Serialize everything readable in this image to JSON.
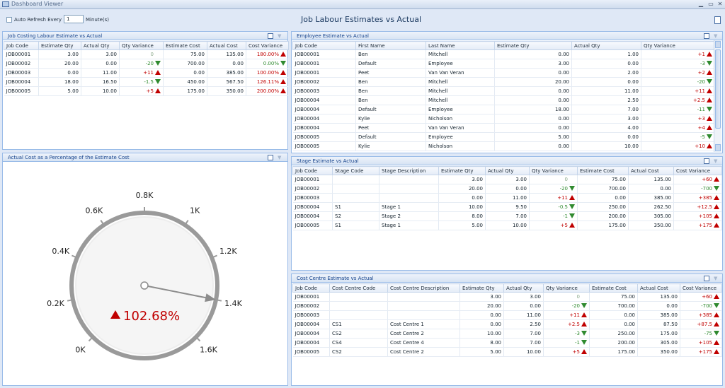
{
  "window": {
    "title": "Dashboard Viewer"
  },
  "toolbar": {
    "auto_refresh_label": "Auto Refresh Every",
    "refresh_value": "1",
    "unit_label": "Minute(s)"
  },
  "dashboard_title": "Job Labour Estimates vs Actual",
  "colors": {
    "up": "#c00000",
    "down": "#2f8a2f",
    "panel_header": "#15428b"
  },
  "job_costing": {
    "title": "Job Costing Labour Estimate vs Actual",
    "columns": [
      "Job Code",
      "Estimate Qty",
      "Actual Qty",
      "Qty Variance",
      "Estimate Cost",
      "Actual Cost",
      "Cost Variance"
    ],
    "rows": [
      {
        "cells": [
          "JOB00001",
          "3.00",
          "3.00",
          "0",
          "75.00",
          "135.00",
          "180.00%"
        ],
        "qty_dir": "none",
        "cost_dir": "up"
      },
      {
        "cells": [
          "JOB00002",
          "20.00",
          "0.00",
          "-20",
          "700.00",
          "0.00",
          "0.00%"
        ],
        "qty_dir": "down",
        "cost_dir": "down"
      },
      {
        "cells": [
          "JOB00003",
          "0.00",
          "11.00",
          "+11",
          "0.00",
          "385.00",
          "100.00%"
        ],
        "qty_dir": "up",
        "cost_dir": "up"
      },
      {
        "cells": [
          "JOB00004",
          "18.00",
          "16.50",
          "-1.5",
          "450.00",
          "567.50",
          "126.11%"
        ],
        "qty_dir": "down",
        "cost_dir": "up"
      },
      {
        "cells": [
          "JOB00005",
          "5.00",
          "10.00",
          "+5",
          "175.00",
          "350.00",
          "200.00%"
        ],
        "qty_dir": "up",
        "cost_dir": "up"
      }
    ]
  },
  "employee": {
    "title": "Employee Estimate vs Actual",
    "columns": [
      "Job Code",
      "First Name",
      "Last Name",
      "Estimate Qty",
      "Actual Qty",
      "Qty Variance"
    ],
    "rows": [
      {
        "cells": [
          "JOB00001",
          "Ben",
          "Mitchell",
          "0.00",
          "1.00",
          "+1"
        ],
        "dir": "up"
      },
      {
        "cells": [
          "JOB00001",
          "Default",
          "Employee",
          "3.00",
          "0.00",
          "-3"
        ],
        "dir": "down"
      },
      {
        "cells": [
          "JOB00001",
          "Peet",
          "Van Van Veran",
          "0.00",
          "2.00",
          "+2"
        ],
        "dir": "up"
      },
      {
        "cells": [
          "JOB00002",
          "Ben",
          "Mitchell",
          "20.00",
          "0.00",
          "-20"
        ],
        "dir": "down"
      },
      {
        "cells": [
          "JOB00003",
          "Ben",
          "Mitchell",
          "0.00",
          "11.00",
          "+11"
        ],
        "dir": "up"
      },
      {
        "cells": [
          "JOB00004",
          "Ben",
          "Mitchell",
          "0.00",
          "2.50",
          "+2.5"
        ],
        "dir": "up"
      },
      {
        "cells": [
          "JOB00004",
          "Default",
          "Employee",
          "18.00",
          "7.00",
          "-11"
        ],
        "dir": "down"
      },
      {
        "cells": [
          "JOB00004",
          "Kylie",
          "Nicholson",
          "0.00",
          "3.00",
          "+3"
        ],
        "dir": "up"
      },
      {
        "cells": [
          "JOB00004",
          "Peet",
          "Van Van Veran",
          "0.00",
          "4.00",
          "+4"
        ],
        "dir": "up"
      },
      {
        "cells": [
          "JOB00005",
          "Default",
          "Employee",
          "5.00",
          "0.00",
          "-5"
        ],
        "dir": "down"
      },
      {
        "cells": [
          "JOB00005",
          "Kylie",
          "Nicholson",
          "0.00",
          "10.00",
          "+10"
        ],
        "dir": "up"
      }
    ]
  },
  "stage": {
    "title": "Stage Estimate vs Actual",
    "columns": [
      "Job Code",
      "Stage Code",
      "Stage Description",
      "Estimate Qty",
      "Actual Qty",
      "Qty Variance",
      "Estimate Cost",
      "Actual Cost",
      "Cost Variance"
    ],
    "rows": [
      {
        "cells": [
          "JOB00001",
          "",
          "",
          "3.00",
          "3.00",
          "0",
          "75.00",
          "135.00",
          "+60"
        ],
        "qty_dir": "none",
        "cost_dir": "up"
      },
      {
        "cells": [
          "JOB00002",
          "",
          "",
          "20.00",
          "0.00",
          "-20",
          "700.00",
          "0.00",
          "-700"
        ],
        "qty_dir": "down",
        "cost_dir": "down"
      },
      {
        "cells": [
          "JOB00003",
          "",
          "",
          "0.00",
          "11.00",
          "+11",
          "0.00",
          "385.00",
          "+385"
        ],
        "qty_dir": "up",
        "cost_dir": "up"
      },
      {
        "cells": [
          "JOB00004",
          "S1",
          "Stage 1",
          "10.00",
          "9.50",
          "-0.5",
          "250.00",
          "262.50",
          "+12.5"
        ],
        "qty_dir": "down",
        "cost_dir": "up"
      },
      {
        "cells": [
          "JOB00004",
          "S2",
          "Stage 2",
          "8.00",
          "7.00",
          "-1",
          "200.00",
          "305.00",
          "+105"
        ],
        "qty_dir": "down",
        "cost_dir": "up"
      },
      {
        "cells": [
          "JOB00005",
          "S1",
          "Stage 1",
          "5.00",
          "10.00",
          "+5",
          "175.00",
          "350.00",
          "+175"
        ],
        "qty_dir": "up",
        "cost_dir": "up"
      }
    ]
  },
  "cost_centre": {
    "title": "Cost Centre Estimate vs Actual",
    "columns": [
      "Job Code",
      "Cost Centre Code",
      "Cost Centre Description",
      "Estimate Qty",
      "Actual Qty",
      "Qty Variance",
      "Estimate Cost",
      "Actual Cost",
      "Cost Variance"
    ],
    "rows": [
      {
        "cells": [
          "JOB00001",
          "",
          "",
          "3.00",
          "3.00",
          "0",
          "75.00",
          "135.00",
          "+60"
        ],
        "qty_dir": "none",
        "cost_dir": "up"
      },
      {
        "cells": [
          "JOB00002",
          "",
          "",
          "20.00",
          "0.00",
          "-20",
          "700.00",
          "0.00",
          "-700"
        ],
        "qty_dir": "down",
        "cost_dir": "down"
      },
      {
        "cells": [
          "JOB00003",
          "",
          "",
          "0.00",
          "11.00",
          "+11",
          "0.00",
          "385.00",
          "+385"
        ],
        "qty_dir": "up",
        "cost_dir": "up"
      },
      {
        "cells": [
          "JOB00004",
          "CS1",
          "Cost Centre 1",
          "0.00",
          "2.50",
          "+2.5",
          "0.00",
          "87.50",
          "+87.5"
        ],
        "qty_dir": "up",
        "cost_dir": "up"
      },
      {
        "cells": [
          "JOB00004",
          "CS2",
          "Cost Centre 2",
          "10.00",
          "7.00",
          "-3",
          "250.00",
          "175.00",
          "-75"
        ],
        "qty_dir": "down",
        "cost_dir": "down"
      },
      {
        "cells": [
          "JOB00004",
          "CS4",
          "Cost Centre 4",
          "8.00",
          "7.00",
          "-1",
          "200.00",
          "305.00",
          "+105"
        ],
        "qty_dir": "down",
        "cost_dir": "up"
      },
      {
        "cells": [
          "JOB00005",
          "CS2",
          "Cost Centre 2",
          "5.00",
          "10.00",
          "+5",
          "175.00",
          "350.00",
          "+175"
        ],
        "qty_dir": "up",
        "cost_dir": "up"
      }
    ]
  },
  "gauge": {
    "title": "Actual Cost as a Percentage of the Estimate Cost",
    "value_label": "102.68%",
    "needle_value": 1.4,
    "min": 0,
    "max": 1.6,
    "ticks": [
      {
        "value": 0,
        "label": "0K"
      },
      {
        "value": 0.2,
        "label": "0.2K"
      },
      {
        "value": 0.4,
        "label": "0.4K"
      },
      {
        "value": 0.6,
        "label": "0.6K"
      },
      {
        "value": 0.8,
        "label": "0.8K"
      },
      {
        "value": 1.0,
        "label": "1K"
      },
      {
        "value": 1.2,
        "label": "1.2K"
      },
      {
        "value": 1.4,
        "label": "1.4K"
      },
      {
        "value": 1.6,
        "label": "1.6K"
      }
    ]
  }
}
